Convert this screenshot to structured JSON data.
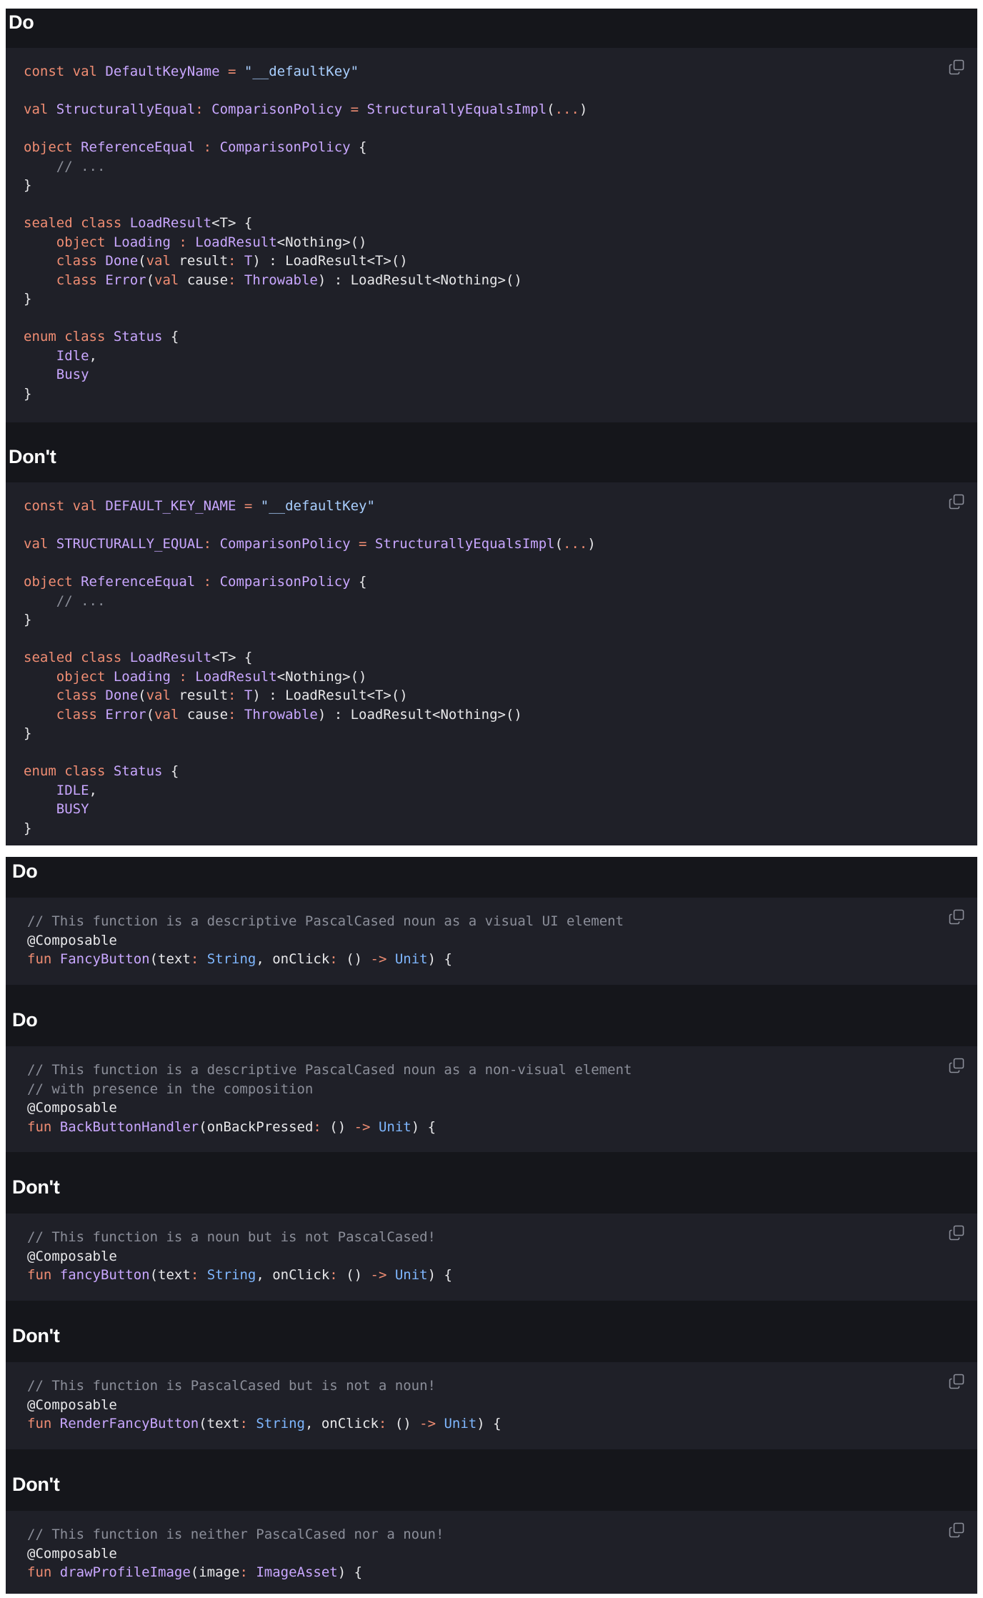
{
  "panels": [
    {
      "blocks": [
        {
          "heading": "Do",
          "lines": [
            [
              [
                "kw",
                "const val "
              ],
              [
                "fn",
                "DefaultKeyName"
              ],
              [
                "op",
                " = "
              ],
              [
                "st",
                "\"__defaultKey\""
              ]
            ],
            [],
            [
              [
                "kw",
                "val "
              ],
              [
                "fn",
                "StructurallyEqual"
              ],
              [
                "op",
                ": "
              ],
              [
                "ty",
                "ComparisonPolicy"
              ],
              [
                "op",
                " = "
              ],
              [
                "fn",
                "StructurallyEqualsImpl"
              ],
              [
                "tx",
                "("
              ],
              [
                "op",
                "..."
              ],
              [
                "tx",
                ")"
              ]
            ],
            [],
            [
              [
                "kw",
                "object "
              ],
              [
                "fn",
                "ReferenceEqual"
              ],
              [
                "op",
                " : "
              ],
              [
                "ty",
                "ComparisonPolicy"
              ],
              [
                "tx",
                " {"
              ]
            ],
            [
              [
                "cm",
                "    // ..."
              ]
            ],
            [
              [
                "tx",
                "}"
              ]
            ],
            [],
            [
              [
                "kw",
                "sealed class "
              ],
              [
                "fn",
                "LoadResult"
              ],
              [
                "tx",
                "<T> {"
              ]
            ],
            [
              [
                "kw",
                "    object "
              ],
              [
                "fn",
                "Loading"
              ],
              [
                "op",
                " : "
              ],
              [
                "fn",
                "LoadResult"
              ],
              [
                "tx",
                "<Nothing>()"
              ]
            ],
            [
              [
                "kw",
                "    class "
              ],
              [
                "fn",
                "Done"
              ],
              [
                "tx",
                "("
              ],
              [
                "kw",
                "val "
              ],
              [
                "tx",
                "result"
              ],
              [
                "op",
                ": "
              ],
              [
                "ty",
                "T"
              ],
              [
                "tx",
                ") : LoadResult<T>()"
              ]
            ],
            [
              [
                "kw",
                "    class "
              ],
              [
                "fn",
                "Error"
              ],
              [
                "tx",
                "("
              ],
              [
                "kw",
                "val "
              ],
              [
                "tx",
                "cause"
              ],
              [
                "op",
                ": "
              ],
              [
                "ty",
                "Throwable"
              ],
              [
                "tx",
                ") : LoadResult<Nothing>()"
              ]
            ],
            [
              [
                "tx",
                "}"
              ]
            ],
            [],
            [
              [
                "kw",
                "enum class "
              ],
              [
                "fn",
                "Status"
              ],
              [
                "tx",
                " {"
              ]
            ],
            [
              [
                "fn",
                "    Idle"
              ],
              [
                "tx",
                ","
              ]
            ],
            [
              [
                "fn",
                "    Busy"
              ]
            ],
            [
              [
                "tx",
                "}"
              ]
            ]
          ]
        },
        {
          "heading": "Don't",
          "lines": [
            [
              [
                "kw",
                "const val "
              ],
              [
                "fn",
                "DEFAULT_KEY_NAME"
              ],
              [
                "op",
                " = "
              ],
              [
                "st",
                "\"__defaultKey\""
              ]
            ],
            [],
            [
              [
                "kw",
                "val "
              ],
              [
                "fn",
                "STRUCTURALLY_EQUAL"
              ],
              [
                "op",
                ": "
              ],
              [
                "ty",
                "ComparisonPolicy"
              ],
              [
                "op",
                " = "
              ],
              [
                "fn",
                "StructurallyEqualsImpl"
              ],
              [
                "tx",
                "("
              ],
              [
                "op",
                "..."
              ],
              [
                "tx",
                ")"
              ]
            ],
            [],
            [
              [
                "kw",
                "object "
              ],
              [
                "fn",
                "ReferenceEqual"
              ],
              [
                "op",
                " : "
              ],
              [
                "ty",
                "ComparisonPolicy"
              ],
              [
                "tx",
                " {"
              ]
            ],
            [
              [
                "cm",
                "    // ..."
              ]
            ],
            [
              [
                "tx",
                "}"
              ]
            ],
            [],
            [
              [
                "kw",
                "sealed class "
              ],
              [
                "fn",
                "LoadResult"
              ],
              [
                "tx",
                "<T> {"
              ]
            ],
            [
              [
                "kw",
                "    object "
              ],
              [
                "fn",
                "Loading"
              ],
              [
                "op",
                " : "
              ],
              [
                "fn",
                "LoadResult"
              ],
              [
                "tx",
                "<Nothing>()"
              ]
            ],
            [
              [
                "kw",
                "    class "
              ],
              [
                "fn",
                "Done"
              ],
              [
                "tx",
                "("
              ],
              [
                "kw",
                "val "
              ],
              [
                "tx",
                "result"
              ],
              [
                "op",
                ": "
              ],
              [
                "ty",
                "T"
              ],
              [
                "tx",
                ") : LoadResult<T>()"
              ]
            ],
            [
              [
                "kw",
                "    class "
              ],
              [
                "fn",
                "Error"
              ],
              [
                "tx",
                "("
              ],
              [
                "kw",
                "val "
              ],
              [
                "tx",
                "cause"
              ],
              [
                "op",
                ": "
              ],
              [
                "ty",
                "Throwable"
              ],
              [
                "tx",
                ") : LoadResult<Nothing>()"
              ]
            ],
            [
              [
                "tx",
                "}"
              ]
            ],
            [],
            [
              [
                "kw",
                "enum class "
              ],
              [
                "fn",
                "Status"
              ],
              [
                "tx",
                " {"
              ]
            ],
            [
              [
                "fn",
                "    IDLE"
              ],
              [
                "tx",
                ","
              ]
            ],
            [
              [
                "fn",
                "    BUSY"
              ]
            ],
            [
              [
                "tx",
                "}"
              ]
            ]
          ]
        }
      ]
    },
    {
      "blocks": [
        {
          "heading": "Do",
          "lines": [
            [
              [
                "cm",
                "// This function is a descriptive PascalCased noun as a visual UI element"
              ]
            ],
            [
              [
                "tx",
                "@Composable"
              ]
            ],
            [
              [
                "kw",
                "fun "
              ],
              [
                "fn",
                "FancyButton"
              ],
              [
                "tx",
                "(text"
              ],
              [
                "op",
                ": "
              ],
              [
                "bl",
                "String"
              ],
              [
                "tx",
                ", onClick"
              ],
              [
                "op",
                ": "
              ],
              [
                "tx",
                "() "
              ],
              [
                "op",
                "->"
              ],
              [
                "bl",
                " Unit"
              ],
              [
                "tx",
                ") {"
              ]
            ]
          ]
        },
        {
          "heading": "Do",
          "lines": [
            [
              [
                "cm",
                "// This function is a descriptive PascalCased noun as a non-visual element"
              ]
            ],
            [
              [
                "cm",
                "// with presence in the composition"
              ]
            ],
            [
              [
                "tx",
                "@Composable"
              ]
            ],
            [
              [
                "kw",
                "fun "
              ],
              [
                "fn",
                "BackButtonHandler"
              ],
              [
                "tx",
                "(onBackPressed"
              ],
              [
                "op",
                ": "
              ],
              [
                "tx",
                "() "
              ],
              [
                "op",
                "->"
              ],
              [
                "bl",
                " Unit"
              ],
              [
                "tx",
                ") {"
              ]
            ]
          ]
        },
        {
          "heading": "Don't",
          "lines": [
            [
              [
                "cm",
                "// This function is a noun but is not PascalCased!"
              ]
            ],
            [
              [
                "tx",
                "@Composable"
              ]
            ],
            [
              [
                "kw",
                "fun "
              ],
              [
                "fn",
                "fancyButton"
              ],
              [
                "tx",
                "(text"
              ],
              [
                "op",
                ": "
              ],
              [
                "bl",
                "String"
              ],
              [
                "tx",
                ", onClick"
              ],
              [
                "op",
                ": "
              ],
              [
                "tx",
                "() "
              ],
              [
                "op",
                "->"
              ],
              [
                "bl",
                " Unit"
              ],
              [
                "tx",
                ") {"
              ]
            ]
          ]
        },
        {
          "heading": "Don't",
          "lines": [
            [
              [
                "cm",
                "// This function is PascalCased but is not a noun!"
              ]
            ],
            [
              [
                "tx",
                "@Composable"
              ]
            ],
            [
              [
                "kw",
                "fun "
              ],
              [
                "fn",
                "RenderFancyButton"
              ],
              [
                "tx",
                "(text"
              ],
              [
                "op",
                ": "
              ],
              [
                "bl",
                "String"
              ],
              [
                "tx",
                ", onClick"
              ],
              [
                "op",
                ": "
              ],
              [
                "tx",
                "() "
              ],
              [
                "op",
                "->"
              ],
              [
                "bl",
                " Unit"
              ],
              [
                "tx",
                ") {"
              ]
            ]
          ]
        },
        {
          "heading": "Don't",
          "lines": [
            [
              [
                "cm",
                "// This function is neither PascalCased nor a noun!"
              ]
            ],
            [
              [
                "tx",
                "@Composable"
              ]
            ],
            [
              [
                "kw",
                "fun "
              ],
              [
                "fn",
                "drawProfileImage"
              ],
              [
                "tx",
                "(image"
              ],
              [
                "op",
                ": "
              ],
              [
                "ty",
                "ImageAsset"
              ],
              [
                "tx",
                ") {"
              ]
            ]
          ]
        }
      ]
    }
  ],
  "icons": {
    "copy": "copy-icon"
  },
  "colors": {
    "panel_bg": "#15161b",
    "code_bg": "#1f2028",
    "keyword": "#f08d73",
    "identifier": "#c9a7ff",
    "string": "#a9cfff",
    "comment": "#8b8e99",
    "builtin_type": "#7fb7ff",
    "text": "#e8e8ea"
  }
}
